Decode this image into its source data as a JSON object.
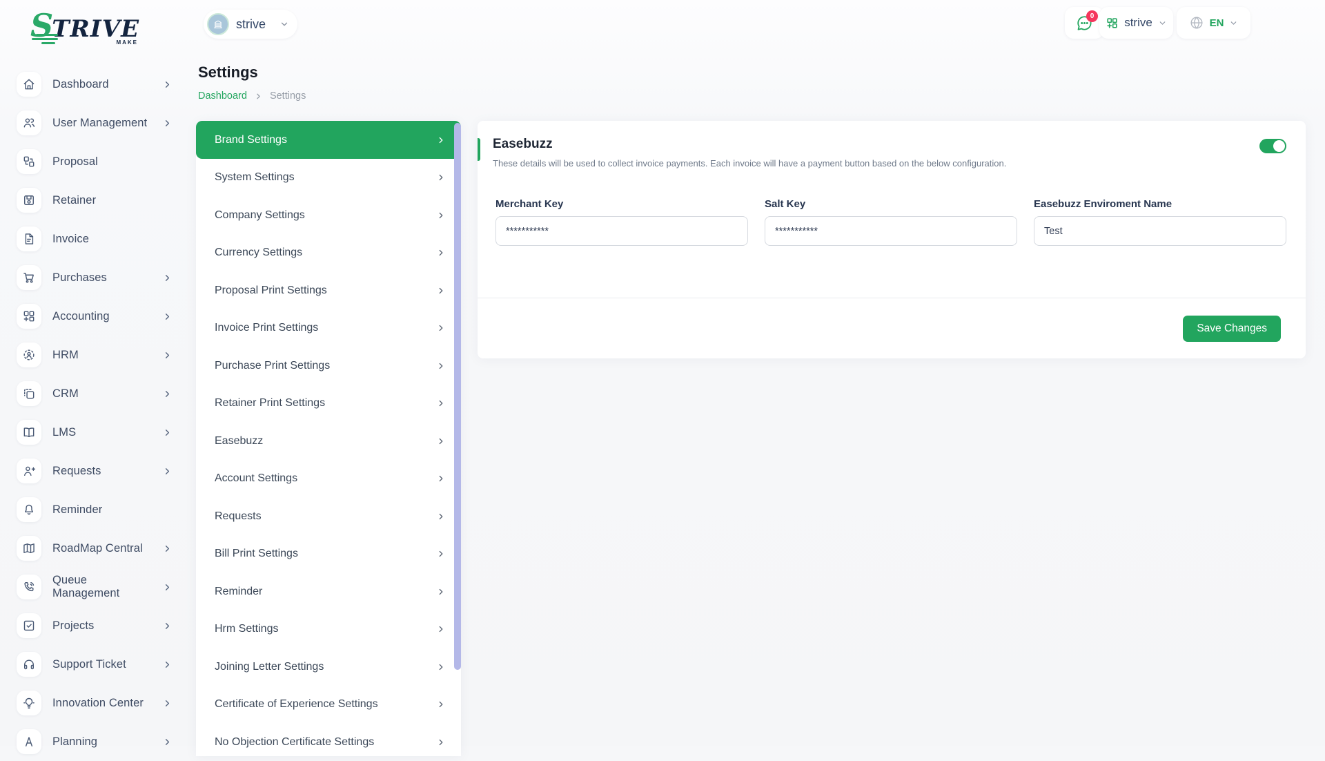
{
  "colors": {
    "accent_green": "#22a55e",
    "badge_red": "#f5365c",
    "scrollbar_lavender": "#b4b8e8",
    "sidebar_text": "#3e4b63"
  },
  "logo": {
    "text_primary": "S",
    "text_rest": "TRIVE",
    "tagline": "MAKE"
  },
  "topbar": {
    "workspace_name": "strive",
    "chat_badge_count": "0",
    "org_name": "strive",
    "language_code": "EN"
  },
  "sidebar": {
    "items": [
      {
        "label": "Dashboard",
        "icon": "home-icon",
        "has_submenu": true
      },
      {
        "label": "User Management",
        "icon": "users-icon",
        "has_submenu": true
      },
      {
        "label": "Proposal",
        "icon": "swap-boxes-icon",
        "has_submenu": false
      },
      {
        "label": "Retainer",
        "icon": "floppy-icon",
        "has_submenu": false
      },
      {
        "label": "Invoice",
        "icon": "file-text-icon",
        "has_submenu": false
      },
      {
        "label": "Purchases",
        "icon": "cart-icon",
        "has_submenu": true
      },
      {
        "label": "Accounting",
        "icon": "grid-plus-icon",
        "has_submenu": true
      },
      {
        "label": "HRM",
        "icon": "user-focus-icon",
        "has_submenu": true
      },
      {
        "label": "CRM",
        "icon": "copy-icon",
        "has_submenu": true
      },
      {
        "label": "LMS",
        "icon": "book-open-icon",
        "has_submenu": true
      },
      {
        "label": "Requests",
        "icon": "user-plus-icon",
        "has_submenu": true
      },
      {
        "label": "Reminder",
        "icon": "bell-icon",
        "has_submenu": false
      },
      {
        "label": "RoadMap Central",
        "icon": "map-icon",
        "has_submenu": true
      },
      {
        "label": "Queue Management",
        "icon": "phone-call-icon",
        "has_submenu": true
      },
      {
        "label": "Projects",
        "icon": "check-square-icon",
        "has_submenu": true
      },
      {
        "label": "Support Ticket",
        "icon": "headphones-icon",
        "has_submenu": true
      },
      {
        "label": "Innovation Center",
        "icon": "lightbulb-icon",
        "has_submenu": true
      },
      {
        "label": "Planning",
        "icon": "letter-a-icon",
        "has_submenu": true
      }
    ]
  },
  "page": {
    "title": "Settings",
    "breadcrumb_home": "Dashboard",
    "breadcrumb_current": "Settings"
  },
  "settings_menu": {
    "items": [
      {
        "label": "Brand Settings",
        "active": true
      },
      {
        "label": "System Settings",
        "active": false
      },
      {
        "label": "Company Settings",
        "active": false
      },
      {
        "label": "Currency Settings",
        "active": false
      },
      {
        "label": "Proposal Print Settings",
        "active": false
      },
      {
        "label": "Invoice Print Settings",
        "active": false
      },
      {
        "label": "Purchase Print Settings",
        "active": false
      },
      {
        "label": "Retainer Print Settings",
        "active": false
      },
      {
        "label": "Easebuzz",
        "active": false
      },
      {
        "label": "Account Settings",
        "active": false
      },
      {
        "label": "Requests",
        "active": false
      },
      {
        "label": "Bill Print Settings",
        "active": false
      },
      {
        "label": "Reminder",
        "active": false
      },
      {
        "label": "Hrm Settings",
        "active": false
      },
      {
        "label": "Joining Letter Settings",
        "active": false
      },
      {
        "label": "Certificate of Experience Settings",
        "active": false
      },
      {
        "label": "No Objection Certificate Settings",
        "active": false
      }
    ]
  },
  "easebuzz_panel": {
    "title": "Easebuzz",
    "description": "These details will be used to collect invoice payments. Each invoice will have a payment button based on the below configuration.",
    "toggle_state": "on",
    "fields": [
      {
        "label": "Merchant Key",
        "value": "***********"
      },
      {
        "label": "Salt Key",
        "value": "***********"
      },
      {
        "label": "Easebuzz Enviroment Name",
        "value": "Test"
      }
    ],
    "save_button_label": "Save Changes"
  }
}
